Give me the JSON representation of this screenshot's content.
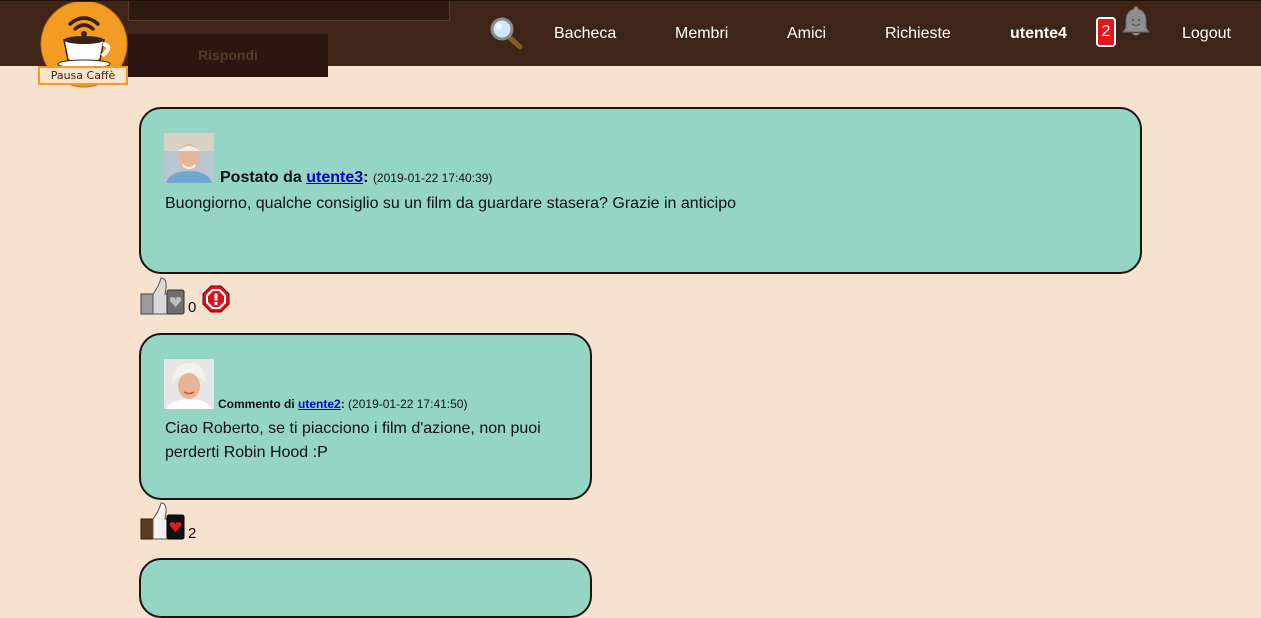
{
  "header": {
    "logo_text": "Pausa Caffè",
    "reply_button_label": "Rispondi",
    "nav": {
      "bacheca": "Bacheca",
      "membri": "Membri",
      "amici": "Amici",
      "richieste": "Richieste",
      "user": "utente4",
      "logout": "Logout"
    },
    "notification_count": "2"
  },
  "post": {
    "prefix": "Postato da",
    "author": "utente3",
    "timestamp": "(2019-01-22 17:40:39)",
    "body": "Buongiorno, qualche consiglio su un film da guardare stasera? Grazie in anticipo",
    "likes": "0"
  },
  "comments": [
    {
      "prefix": "Commento di",
      "author": "utente2",
      "timestamp": "(2019-01-22 17:41:50)",
      "body": "Ciao Roberto, se ti piacciono i film d'azione, non puoi perderti Robin Hood :P",
      "likes": "2"
    }
  ],
  "colors": {
    "navbar": "#3e2517",
    "background": "#f7e1cf",
    "card": "#95d5c4",
    "badge": "#e4141c",
    "link": "#0000cc"
  },
  "icons": [
    "logo-icon",
    "search-icon",
    "bell-icon",
    "like-icon",
    "report-icon",
    "avatar"
  ]
}
